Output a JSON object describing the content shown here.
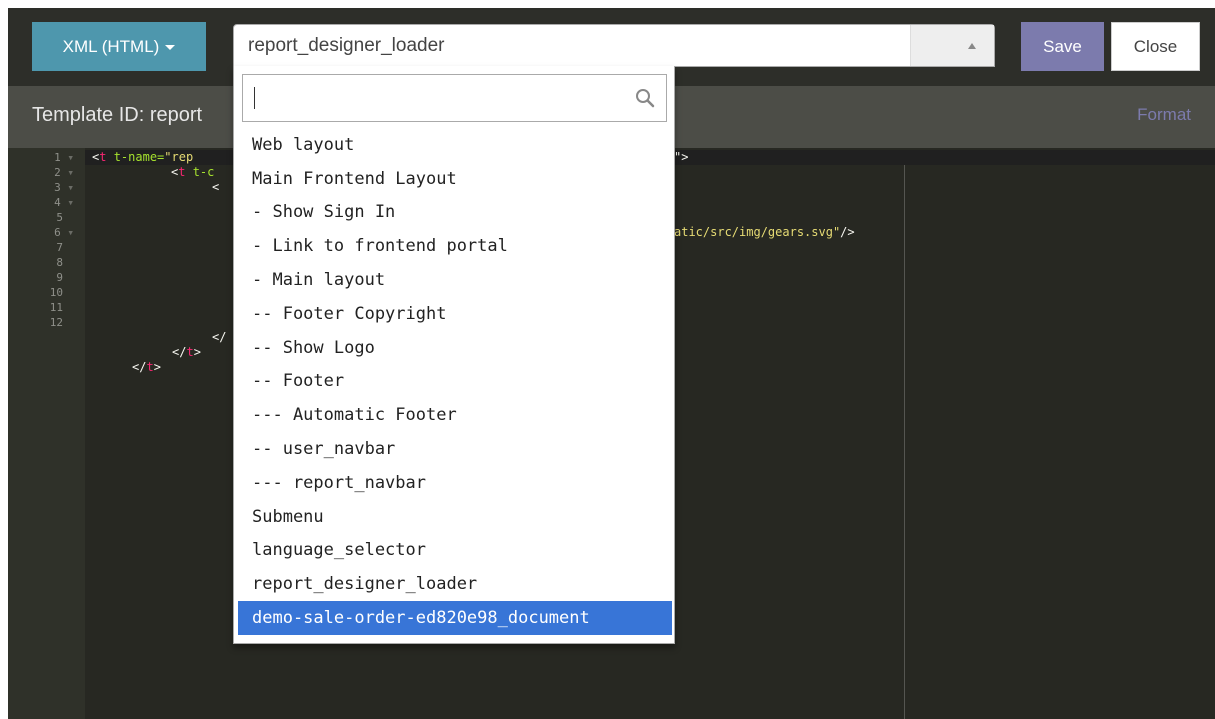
{
  "toolbar": {
    "language_button": "XML (HTML)",
    "select_value": "report_designer_loader",
    "save_label": "Save",
    "close_label": "Close"
  },
  "header": {
    "template_label": "Template ID: report",
    "format_link": "Format"
  },
  "editor": {
    "line_numbers": [
      "1",
      "2",
      "3",
      "4",
      "5",
      "6",
      "7",
      "8",
      "9",
      "10",
      "11",
      "12"
    ],
    "line1": {
      "open": "<",
      "tag": "t",
      "attr": " t-name=",
      "str": "\"rep"
    },
    "line1_tail": "\">",
    "line2": {
      "open": "<",
      "tag": "t",
      "attr": " t-c"
    },
    "line3": {
      "open": "<"
    },
    "line5_tail": {
      "str": "atic/src/img/gears.svg\"",
      "close": "/>"
    },
    "line10": {
      "open": "</"
    },
    "line11": {
      "open": "</",
      "tag": "t",
      "close": ">"
    },
    "line12": {
      "open": "</",
      "tag": "t",
      "close": ">"
    }
  },
  "dropdown": {
    "search_value": "",
    "options": [
      "Web layout",
      "Main Frontend Layout",
      "- Show Sign In",
      "- Link to frontend portal",
      "- Main layout",
      "-- Footer Copyright",
      "-- Show Logo",
      "-- Footer",
      "--- Automatic Footer",
      "-- user_navbar",
      "--- report_navbar",
      "Submenu",
      "language_selector",
      "report_designer_loader",
      "demo-sale-order-ed820e98_document"
    ],
    "selected_index": 14
  },
  "colors": {
    "accent_blue": "#4e97ad",
    "accent_purple": "#7c7bad",
    "selected_option": "#3875d7",
    "editor_background": "#272822"
  }
}
